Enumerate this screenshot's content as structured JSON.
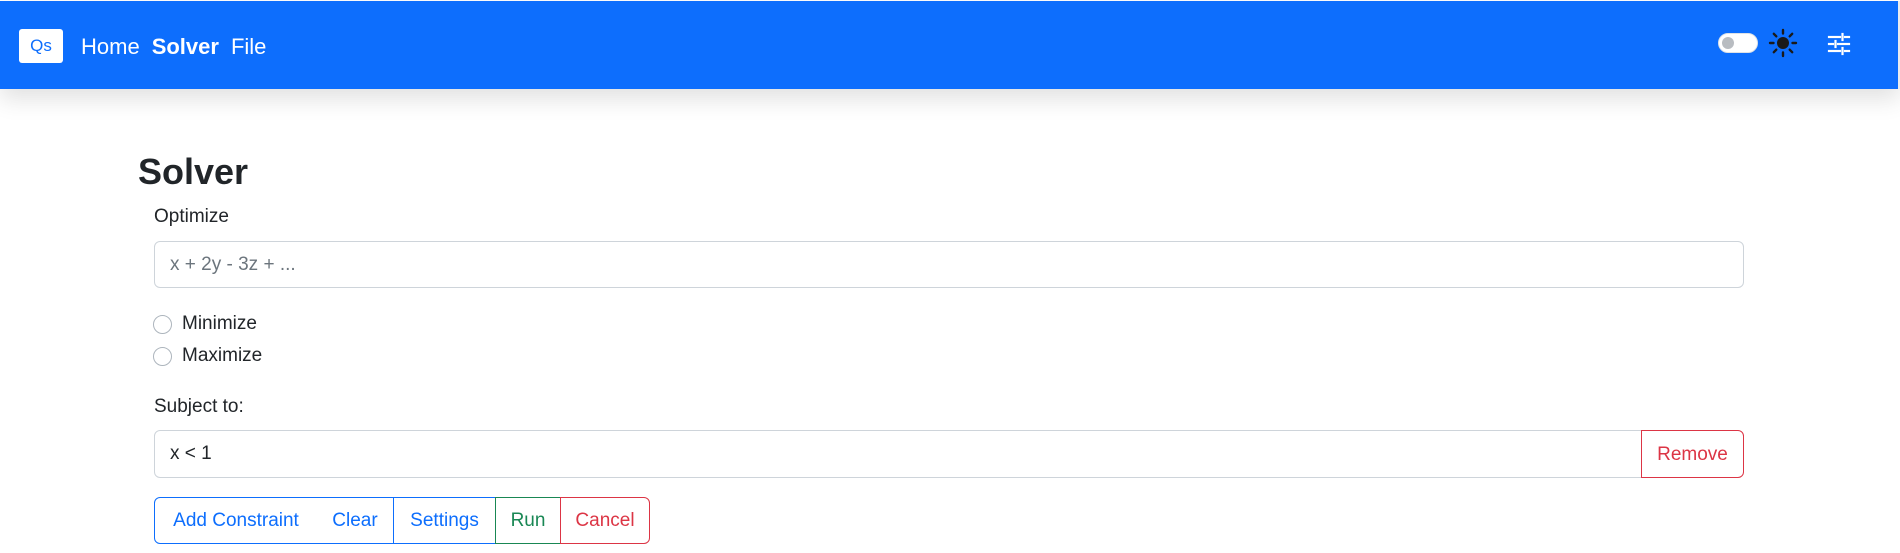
{
  "navbar": {
    "brand": "Qs",
    "links": [
      {
        "label": "Home"
      },
      {
        "label": "Solver"
      },
      {
        "label": "File"
      }
    ],
    "icons": [
      "theme-toggle",
      "sun-icon",
      "tune-icon"
    ]
  },
  "solver": {
    "title": "Solver",
    "optimize_label": "Optimize",
    "objective_placeholder": "x + 2y - 3z + ...",
    "objective_value": "",
    "options": [
      {
        "label": "Minimize",
        "checked": false
      },
      {
        "label": "Maximize",
        "checked": false
      }
    ],
    "subject_label": "Subject to:",
    "constraints": [
      {
        "value": "x < 1",
        "remove_label": "Remove"
      }
    ],
    "actions": {
      "add_constraint": "Add Constraint",
      "clear": "Clear",
      "settings": "Settings",
      "run": "Run",
      "cancel": "Cancel"
    }
  },
  "colors": {
    "primary": "#0d6efd",
    "success": "#198754",
    "danger": "#dc3545",
    "text": "#212529",
    "border": "#ced4da"
  }
}
